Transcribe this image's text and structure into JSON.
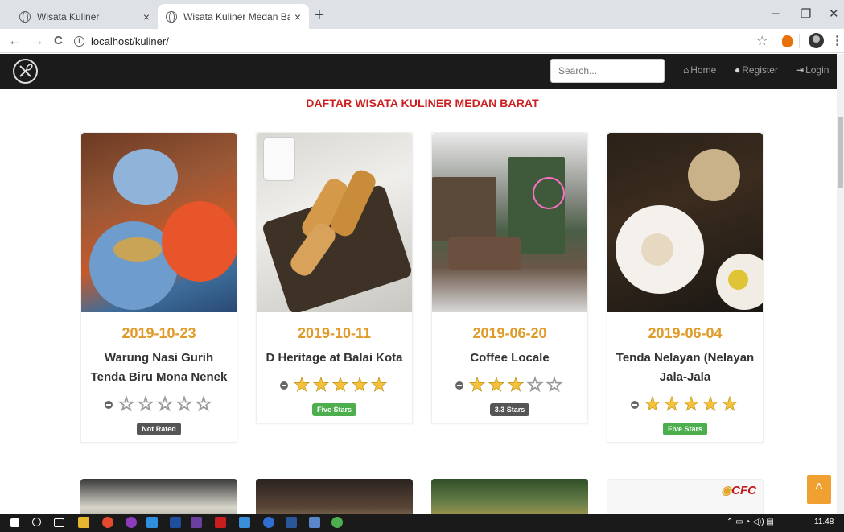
{
  "browser": {
    "tabs": [
      {
        "title": "Wisata Kuliner",
        "close": "×"
      },
      {
        "title": "Wisata Kuliner Medan Barat",
        "close": "×"
      }
    ],
    "new_tab": "+",
    "window_controls": {
      "minimize": "–",
      "maximize": "❐",
      "close": "✕"
    },
    "nav": {
      "back": "←",
      "forward": "→",
      "reload": "C"
    },
    "url": "localhost/kuliner/",
    "info_glyph": "i",
    "bookmark_glyph": "☆",
    "menu_glyph": "⋮"
  },
  "navbar": {
    "search_placeholder": "Search...",
    "links": [
      {
        "icon": "home-icon",
        "glyph": "⌂",
        "label": "Home"
      },
      {
        "icon": "user-icon",
        "glyph": "●",
        "label": "Register"
      },
      {
        "icon": "login-icon",
        "glyph": "⇥",
        "label": "Login"
      }
    ]
  },
  "page": {
    "heading": "DAFTAR WISATA KULINER MEDAN BARAT",
    "cards": [
      {
        "date": "2019-10-23",
        "name": "Warung Nasi Gurih Tenda Biru Mona Nenek",
        "rating": 0,
        "badge": "Not Rated",
        "badge_color": "#555555"
      },
      {
        "date": "2019-10-11",
        "name": "D Heritage at Balai Kota",
        "rating": 5,
        "badge": "Five Stars",
        "badge_color": "#4cae4c"
      },
      {
        "date": "2019-06-20",
        "name": "Coffee Locale",
        "rating": 3,
        "badge": "3.3 Stars",
        "badge_color": "#555555"
      },
      {
        "date": "2019-06-04",
        "name": "Tenda Nelayan (Nelayan Jala-Jala",
        "rating": 5,
        "badge": "Five Stars",
        "badge_color": "#4cae4c"
      }
    ],
    "partial_logo": "CFC",
    "back_to_top_glyph": "^"
  },
  "taskbar": {
    "clock": "11.48"
  },
  "colors": {
    "heading": "#cc2020",
    "date": "#e09a28",
    "star_filled": "#f5c13a",
    "navbar_bg": "#1b1b1b",
    "back_to_top": "#f0a030"
  }
}
